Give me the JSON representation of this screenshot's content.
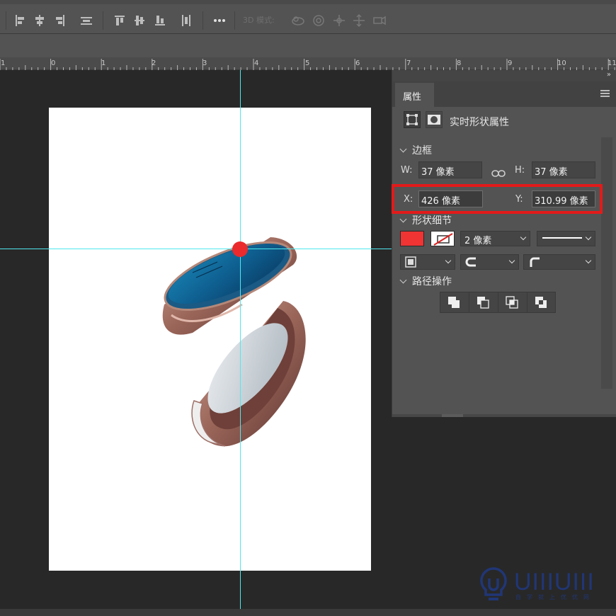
{
  "options_bar": {
    "mode_3d_label": "3D 模式:",
    "align_icons": [
      "align-left-edges-icon",
      "align-horizontal-centers-icon",
      "align-right-edges-icon",
      "distribute-horizontal-icon",
      "align-top-edges-icon",
      "align-vertical-centers-icon",
      "align-bottom-edges-icon",
      "distribute-vertical-icon",
      "more-options-icon"
    ],
    "mode_3d_icons": [
      "orbit-3d-icon",
      "roll-3d-icon",
      "pan-3d-icon",
      "slide-3d-icon",
      "scale-3d-icon"
    ]
  },
  "ruler": {
    "labels": [
      "1",
      "0",
      "1",
      "2",
      "3",
      "4",
      "5",
      "6",
      "7",
      "8",
      "9",
      "10",
      "11"
    ]
  },
  "canvas": {
    "guide_color": "#4fe8ee",
    "marker_color": "#ea2a2c"
  },
  "properties_panel": {
    "tab_label": "属性",
    "title": "实时形状属性",
    "sections": {
      "bounds": {
        "label": "边框",
        "w_label": "W:",
        "w_value": "37 像素",
        "h_label": "H:",
        "h_value": "37 像素",
        "x_label": "X:",
        "x_value": "426 像素",
        "y_label": "Y:",
        "y_value": "310.99 像素"
      },
      "shape_details": {
        "label": "形状细节",
        "fill_color": "#f03333",
        "stroke_width": "2 像素"
      },
      "path_ops": {
        "label": "路径操作"
      }
    },
    "highlight_color": "#e31a1a"
  },
  "watermark": {
    "logo_text": "UIIIUIII",
    "sub_text": "自学就上优优网"
  }
}
